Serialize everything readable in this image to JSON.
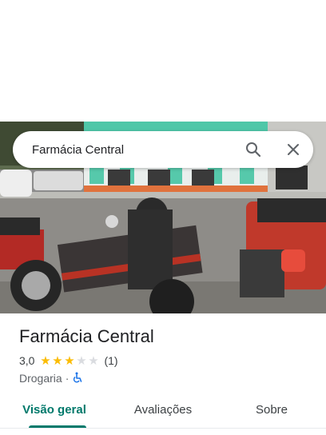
{
  "search": {
    "query": "Farmácia Central",
    "search_icon": "search-icon",
    "close_icon": "close-icon"
  },
  "place": {
    "name": "Farmácia Central",
    "rating": "3,0",
    "stars_filled": 3,
    "stars_total": 5,
    "review_count": "(1)",
    "category": "Drogaria",
    "separator": "·",
    "accessibility_icon": "wheelchair-icon"
  },
  "tabs": [
    {
      "label": "Visão geral",
      "active": true
    },
    {
      "label": "Avaliações",
      "active": false
    },
    {
      "label": "Sobre",
      "active": false
    }
  ],
  "colors": {
    "accent": "#00796b",
    "star": "#fbbc04",
    "star_empty": "#dadce0",
    "accessibility_icon": "#1a73e8"
  }
}
